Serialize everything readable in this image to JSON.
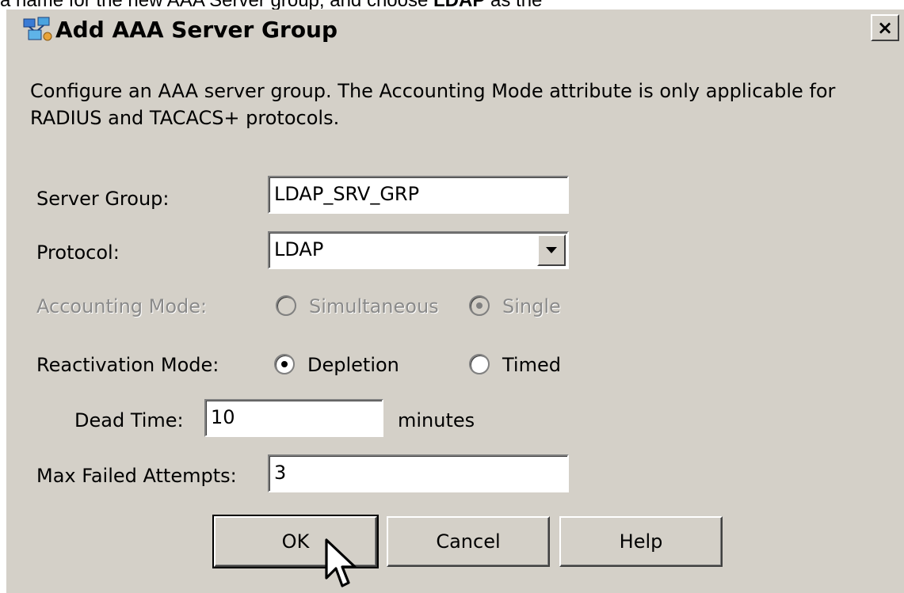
{
  "background": {
    "text_before": "a name for the new AAA Server group, and choose ",
    "text_bold": "LDAP",
    "text_after": " as the"
  },
  "dialog": {
    "title": "Add AAA Server Group",
    "close_label": "×",
    "description": "Configure an AAA server group. The Accounting Mode attribute is only applicable for RADIUS and TACACS+ protocols."
  },
  "form": {
    "server_group_label": "Server Group:",
    "server_group_value": "LDAP_SRV_GRP",
    "protocol_label": "Protocol:",
    "protocol_value": "LDAP",
    "accounting_label": "Accounting Mode:",
    "accounting_options": [
      "Simultaneous",
      "Single"
    ],
    "accounting_selected": "Single",
    "reactivation_label": "Reactivation Mode:",
    "reactivation_options": [
      "Depletion",
      "Timed"
    ],
    "reactivation_selected": "Depletion",
    "dead_time_label": "Dead Time:",
    "dead_time_value": "10",
    "dead_time_unit": "minutes",
    "max_failed_label": "Max Failed Attempts:",
    "max_failed_value": "3"
  },
  "buttons": {
    "ok": "OK",
    "cancel": "Cancel",
    "help": "Help"
  },
  "icons": {
    "title": "network-group-icon",
    "close": "close-icon",
    "dropdown": "chevron-down-icon",
    "pointer": "mouse-pointer-icon"
  }
}
